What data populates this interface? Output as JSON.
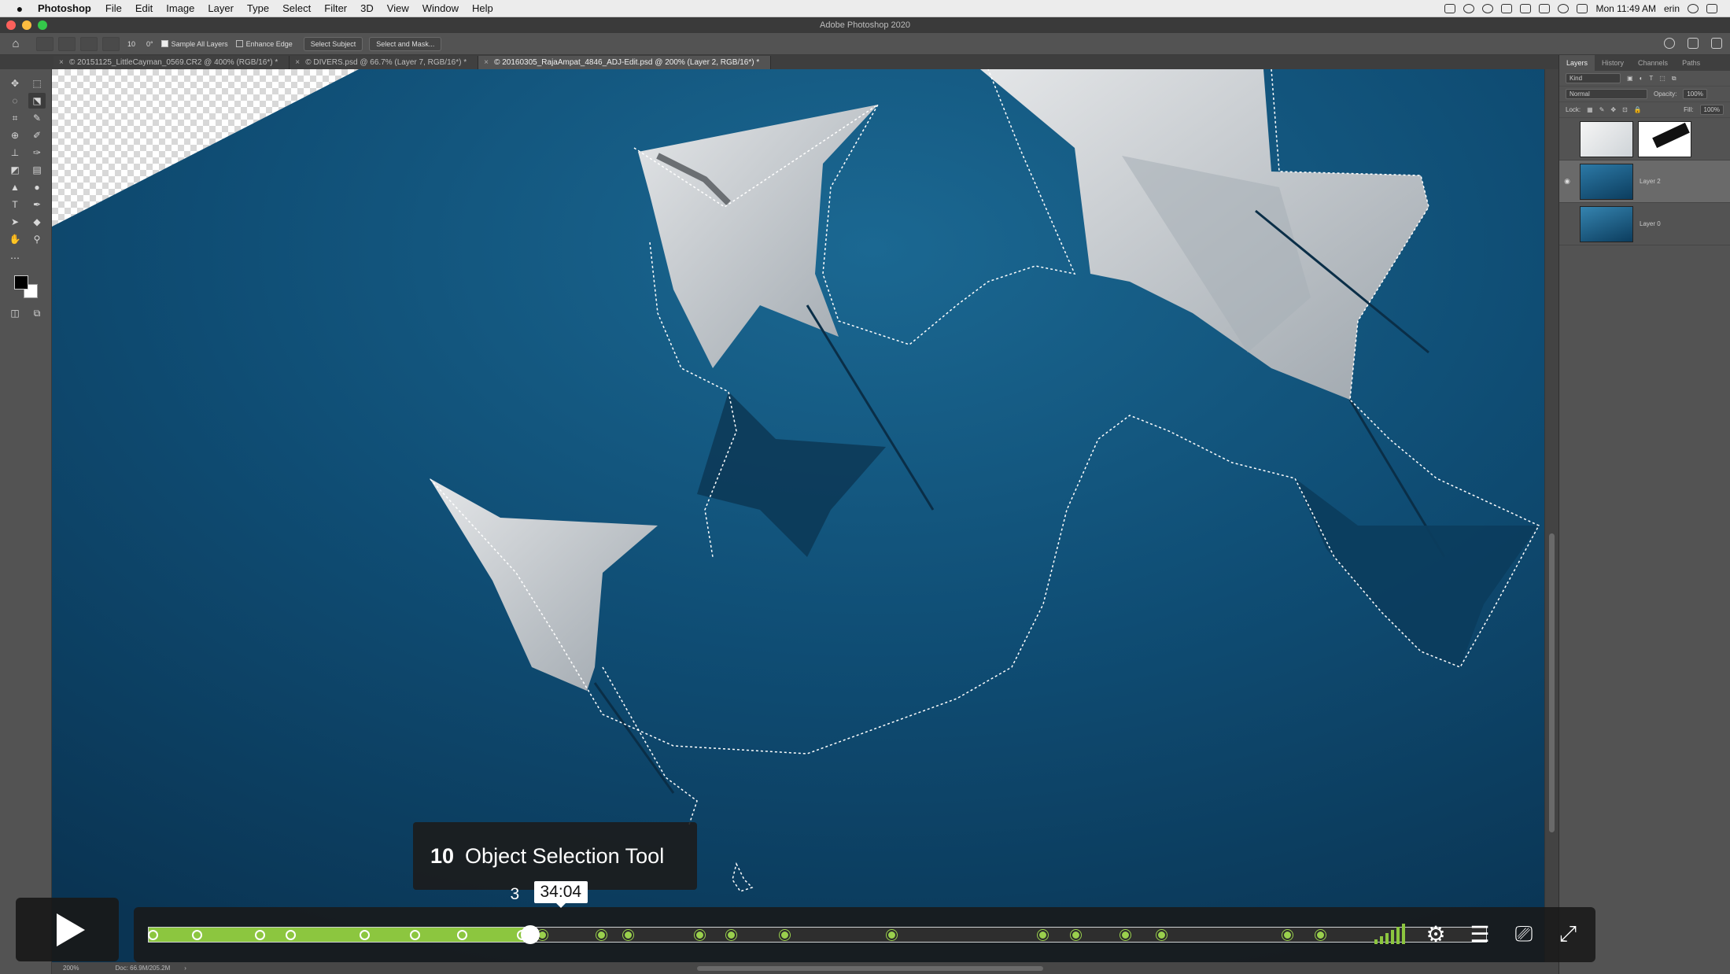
{
  "menubar": {
    "app_name": "Photoshop",
    "menus": [
      "File",
      "Edit",
      "Image",
      "Layer",
      "Type",
      "Select",
      "Filter",
      "3D",
      "View",
      "Window",
      "Help"
    ],
    "clock": "Mon 11:49 AM",
    "user": "erin"
  },
  "window": {
    "title": "Adobe Photoshop 2020"
  },
  "options": {
    "brush_size": "10",
    "angle": "0°",
    "sample_all_layers": "Sample All Layers",
    "enhance_edge": "Enhance Edge",
    "select_subject": "Select Subject",
    "select_and_mask": "Select and Mask..."
  },
  "tabs": [
    {
      "label": "© 20151125_LittleCayman_0569.CR2 @ 400% (RGB/16*) *"
    },
    {
      "label": "© DIVERS.psd @ 66.7% (Layer 7, RGB/16*) *"
    },
    {
      "label": "© 20160305_RajaAmpat_4846_ADJ-Edit.psd @ 200% (Layer 2, RGB/16*) *"
    }
  ],
  "layers_panel": {
    "tabs": [
      "Layers",
      "History",
      "Channels",
      "Paths"
    ],
    "filter": "Kind",
    "blend_mode": "Normal",
    "opacity_label": "Opacity:",
    "opacity": "100%",
    "lock_label": "Lock:",
    "fill_label": "Fill:",
    "fill": "100%",
    "layers": [
      {
        "name": ""
      },
      {
        "name": "Layer 2"
      },
      {
        "name": "Layer 0"
      }
    ]
  },
  "status": {
    "zoom": "200%",
    "doc": "Doc: 66.9M/205.2M"
  },
  "video": {
    "chapter_number": "10",
    "chapter_title": "Object Selection Tool",
    "hover_time": "34:04",
    "current_time_prefix": "3",
    "progress": 0.285,
    "buffered": 0.29,
    "chapter_positions": [
      0.003,
      0.036,
      0.083,
      0.106,
      0.161,
      0.199,
      0.234,
      0.279,
      0.294,
      0.338,
      0.358,
      0.412,
      0.435,
      0.475,
      0.555,
      0.668,
      0.693,
      0.73,
      0.757,
      0.851,
      0.876
    ]
  },
  "colors": {
    "accent": "#8cc63f",
    "ocean": "#0f4d74"
  }
}
